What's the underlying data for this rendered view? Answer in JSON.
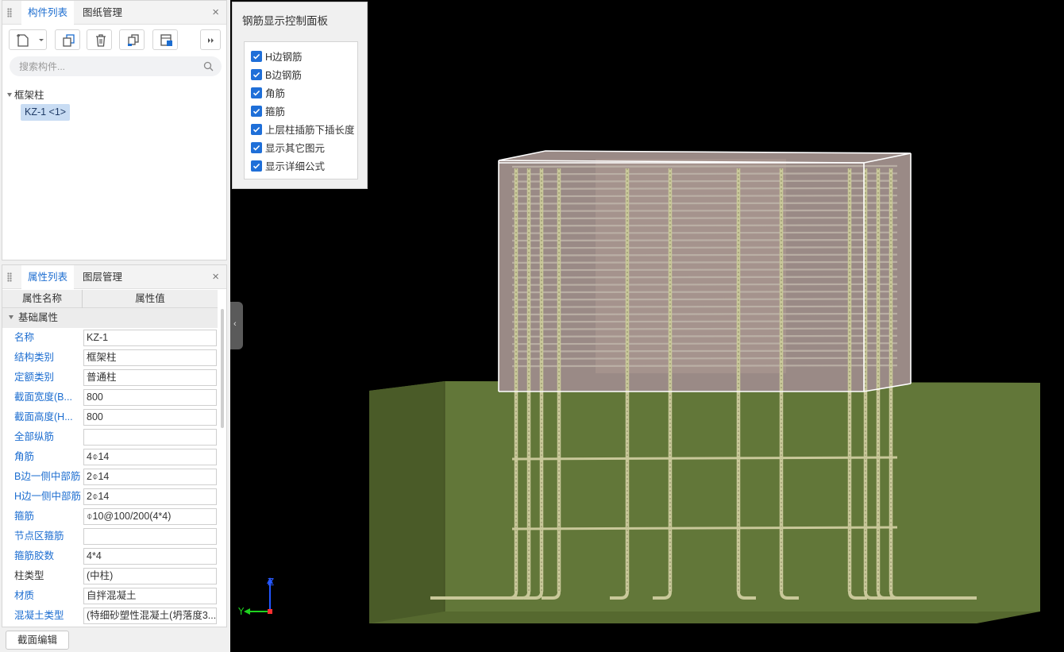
{
  "component_panel": {
    "tabs": [
      {
        "label": "构件列表",
        "active": true
      },
      {
        "label": "图纸管理",
        "active": false
      }
    ],
    "close": "×",
    "search_placeholder": "搜索构件...",
    "tree": {
      "group_label": "框架柱",
      "items": [
        {
          "label": "KZ-1 <1>",
          "selected": true
        }
      ]
    },
    "toolbar_icons": [
      "new-component-icon",
      "dropdown-arrow-icon",
      "copy-icon",
      "delete-icon",
      "copy-to-floor-icon",
      "floor-copy-icon",
      "more-icon"
    ]
  },
  "property_panel": {
    "tabs": [
      {
        "label": "属性列表",
        "active": true
      },
      {
        "label": "图层管理",
        "active": false
      }
    ],
    "close": "×",
    "header": {
      "name_col": "属性名称",
      "value_col": "属性值"
    },
    "section": "基础属性",
    "rows": [
      {
        "name": "名称",
        "value": "KZ-1",
        "color": "blue"
      },
      {
        "name": "结构类别",
        "value": "框架柱",
        "color": "blue"
      },
      {
        "name": "定额类别",
        "value": "普通柱",
        "color": "blue"
      },
      {
        "name": "截面宽度(B...",
        "value": "800",
        "color": "blue"
      },
      {
        "name": "截面高度(H...",
        "value": "800",
        "color": "blue"
      },
      {
        "name": "全部纵筋",
        "value": "",
        "color": "blue"
      },
      {
        "name": "角筋",
        "value": "4⌽14",
        "color": "blue"
      },
      {
        "name": "B边一侧中部筋",
        "value": "2⌽14",
        "color": "blue"
      },
      {
        "name": "H边一侧中部筋",
        "value": "2⌽14",
        "color": "blue"
      },
      {
        "name": "箍筋",
        "value": "⌽10@100/200(4*4)",
        "color": "blue"
      },
      {
        "name": "节点区箍筋",
        "value": "",
        "color": "blue"
      },
      {
        "name": "箍筋胶数",
        "value": "4*4",
        "color": "blue"
      },
      {
        "name": "柱类型",
        "value": "(中柱)",
        "color": "black"
      },
      {
        "name": "材质",
        "value": "自拌混凝土",
        "color": "blue"
      },
      {
        "name": "混凝土类型",
        "value": "(特细砂塑性混凝土(坍落度3...",
        "color": "blue"
      }
    ]
  },
  "section_edit_button": "截面编辑",
  "control_panel": {
    "title": "钢筋显示控制面板",
    "options": [
      {
        "label": "H边钢筋",
        "checked": true
      },
      {
        "label": "B边钢筋",
        "checked": true
      },
      {
        "label": "角筋",
        "checked": true
      },
      {
        "label": "箍筋",
        "checked": true
      },
      {
        "label": "上层柱插筋下插长度",
        "checked": true
      },
      {
        "label": "显示其它图元",
        "checked": true
      },
      {
        "label": "显示详细公式",
        "checked": true
      }
    ]
  },
  "axis": {
    "z_label": "Z",
    "y_label": "Y"
  },
  "colors": {
    "accent": "#1c6dd0",
    "foundation": "#5e7338",
    "column_fill": "#9a8a86",
    "rebar": "#c9c89a",
    "wireframe": "#ffffff",
    "viewport_bg": "#000000"
  }
}
